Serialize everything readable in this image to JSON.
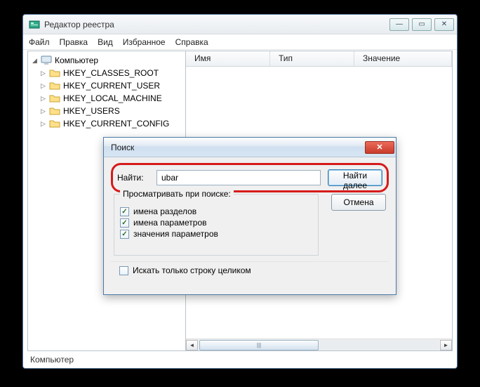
{
  "window": {
    "title": "Редактор реестра",
    "menu": [
      "Файл",
      "Правка",
      "Вид",
      "Избранное",
      "Справка"
    ],
    "winbuttons": {
      "min": "—",
      "max": "▭",
      "close": "✕"
    }
  },
  "tree": {
    "root": "Компьютер",
    "keys": [
      "HKEY_CLASSES_ROOT",
      "HKEY_CURRENT_USER",
      "HKEY_LOCAL_MACHINE",
      "HKEY_USERS",
      "HKEY_CURRENT_CONFIG"
    ]
  },
  "list": {
    "columns": {
      "name": "Имя",
      "type": "Тип",
      "value": "Значение"
    }
  },
  "statusbar": "Компьютер",
  "dialog": {
    "title": "Поиск",
    "find_label": "Найти:",
    "find_value": "ubar",
    "find_next": "Найти далее",
    "cancel": "Отмена",
    "group_title": "Просматривать при поиске:",
    "checks": [
      "имена разделов",
      "имена параметров",
      "значения параметров"
    ],
    "whole_string": "Искать только строку целиком",
    "close_glyph": "✕",
    "check_glyph": "✓"
  },
  "glyphs": {
    "minus": "—",
    "max": "▭",
    "close": "✕",
    "tri_down": "◢",
    "tri_right": "▷",
    "scroll_l": "◄",
    "scroll_r": "►",
    "grip": "|||"
  }
}
